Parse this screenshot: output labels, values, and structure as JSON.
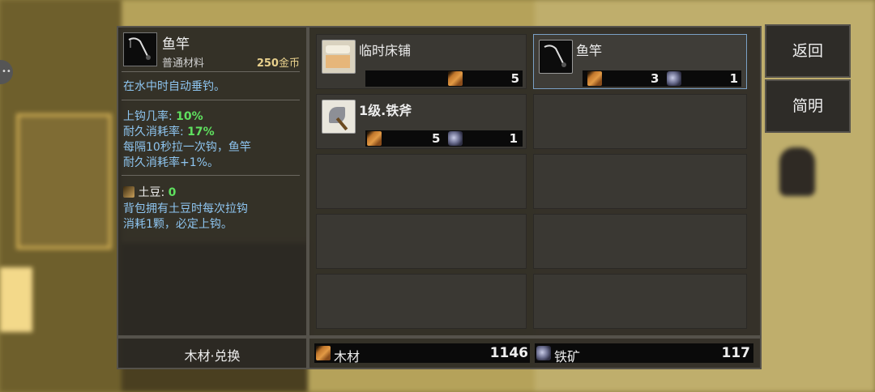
{
  "item": {
    "name": "鱼竿",
    "category": "普通材料",
    "price": "250",
    "price_unit": "金币",
    "description": "在水中时自动垂钓。",
    "stats": {
      "bite_label": "上钩几率:",
      "bite_value": "10%",
      "wear_label": "耐久消耗率:",
      "wear_value": "17%",
      "note_line1": "每隔10秒拉一次钩，鱼竿",
      "note_line2": "耐久消耗率+1%。"
    },
    "bait": {
      "label": "土豆:",
      "value": "0",
      "line1": "背包拥有土豆时每次拉钩",
      "line2": "消耗1颗，必定上钩。"
    }
  },
  "exchange_label": "木材·兑换",
  "recipes": [
    {
      "name": "临时床铺",
      "icon": "bed-icon",
      "costs": [
        {
          "res": "wood-icon",
          "amount": "5"
        }
      ]
    },
    {
      "name": "鱼竿",
      "icon": "fishing-rod-icon",
      "selected": true,
      "costs": [
        {
          "res": "wood-icon",
          "amount": "3"
        },
        {
          "res": "iron-ore-icon",
          "amount": "1"
        }
      ]
    },
    {
      "name": "1级.铁斧",
      "icon": "iron-axe-icon",
      "costs": [
        {
          "res": "wood-icon",
          "amount": "5"
        },
        {
          "res": "iron-ore-icon",
          "amount": "1"
        }
      ]
    }
  ],
  "resources": {
    "wood_label": "木材",
    "wood_count": "1146",
    "iron_label": "铁矿",
    "iron_count": "117"
  },
  "buttons": {
    "back": "返回",
    "info": "简明"
  },
  "colors": {
    "accent_green": "#5fe05f",
    "accent_blue": "#8ec5f0",
    "gold": "#e8d08c",
    "selected_border": "#7aa0c4"
  }
}
